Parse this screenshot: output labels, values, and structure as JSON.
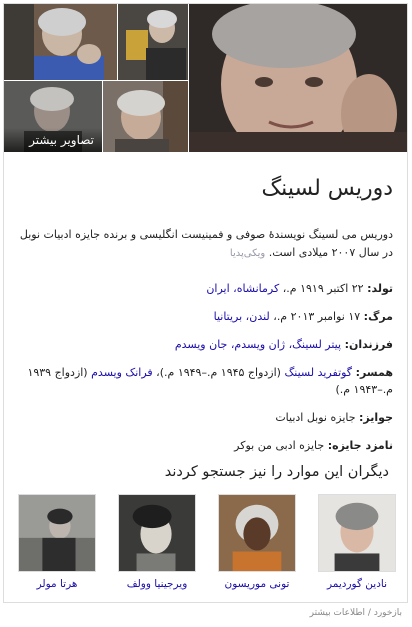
{
  "gallery": {
    "more_images_label": "تصاویر بیشتر"
  },
  "entity": {
    "title": "دوریس لسینگ",
    "description": "دوریس می لسینگ نویسندهٔ صوفی و فمینیست انگلیسی و برنده جایزه ادبیات نوبل در سال ۲۰۰۷ میلادی است.",
    "source": "ویکی‌پدیا"
  },
  "facts": [
    {
      "label": "تولد:",
      "value": "۲۲ اکتبر ۱۹۱۹ م.، ",
      "links": "کرمانشاه، ایران"
    },
    {
      "label": "مرگ:",
      "value": "۱۷ نوامبر ۲۰۱۳ م.، ",
      "links": "لندن، بریتانیا"
    },
    {
      "label": "فرزندان:",
      "value": "",
      "links": "پیتر لسینگ، ژان ویسدم، جان ویسدم"
    },
    {
      "label": "همسر:",
      "value": "",
      "links": "گوتفرید لسینگ",
      "value2": " (ازدواج ۱۹۴۵ م.–۱۹۴۹ م.)، ",
      "links2": "فرانک ویسدم",
      "value3": " (ازدواج ۱۹۳۹ م.–۱۹۴۳ م.)"
    },
    {
      "label": "جوایز:",
      "value": "جایزه نوبل ادبیات",
      "links": ""
    },
    {
      "label": "نامزد جایزه:",
      "value": "جایزه ادبی من بوکر",
      "links": ""
    }
  ],
  "people_also_search": {
    "title": "دیگران این موارد را نیز جستجو کردند",
    "people": [
      {
        "name": "نادین گوردیمر"
      },
      {
        "name": "تونی موریسون"
      },
      {
        "name": "ویرجینیا وولف"
      },
      {
        "name": "هرتا مولر"
      }
    ]
  },
  "footer": {
    "feedback": "بازخورد",
    "separator": " / ",
    "more_info": "اطلاعات بیشتر"
  },
  "colors": {
    "link": "#1a0dab",
    "text": "#222222",
    "muted": "#888888"
  }
}
